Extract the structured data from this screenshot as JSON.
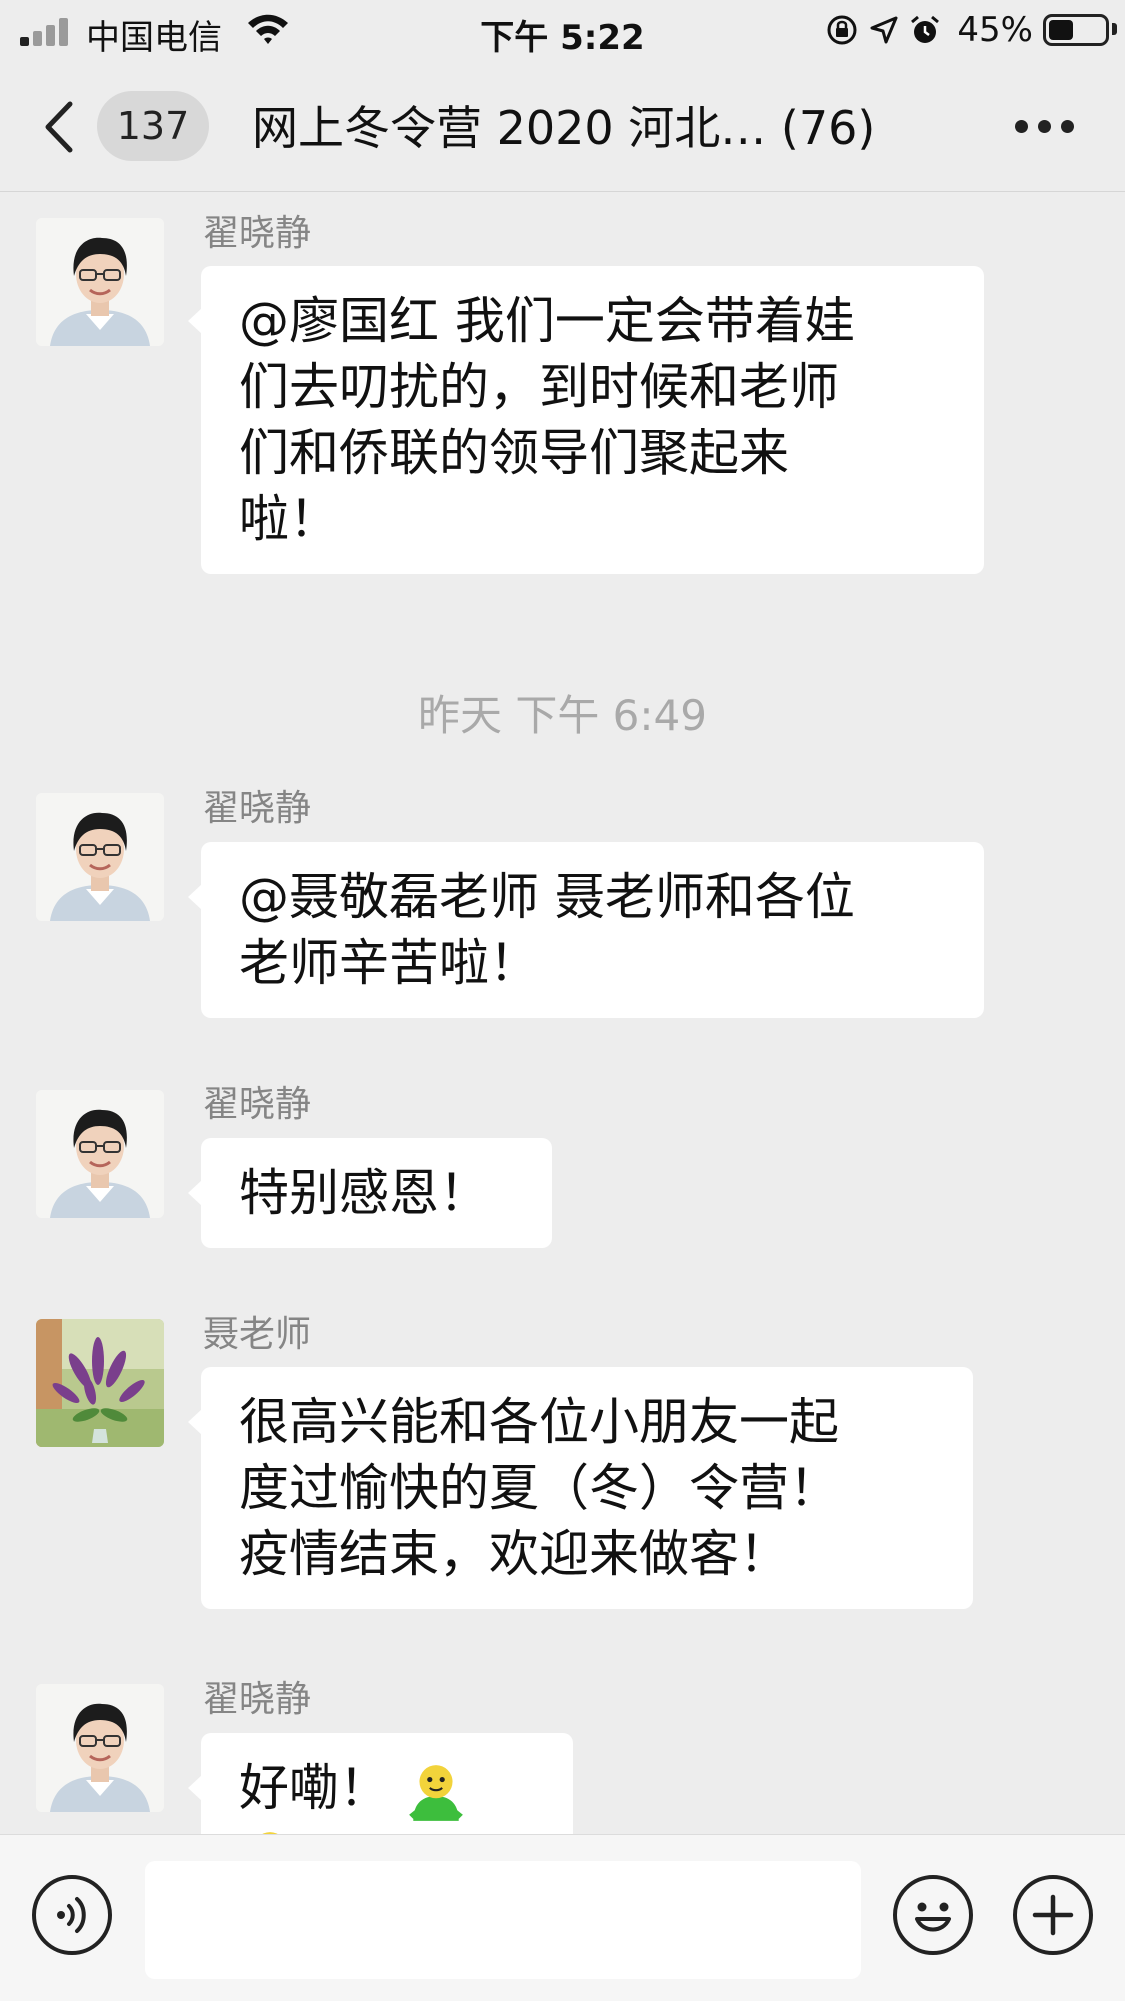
{
  "status_bar": {
    "carrier": "中国电信",
    "time": "下午 5:22",
    "battery_percent": "45%",
    "battery_level": 0.45,
    "icons": [
      "signal-icon",
      "wifi-icon",
      "orientation-lock-icon",
      "location-icon",
      "alarm-icon",
      "battery-icon"
    ]
  },
  "nav": {
    "back_icon": "chevron-left-icon",
    "unread_count": "137",
    "title": "网上冬令营 2020 河北… (76)",
    "more_icon": "more-icon"
  },
  "messages": [
    {
      "sender": "翟晓静",
      "lines": [
        "@廖国红 我们一定会带着娃",
        "们去叨扰的，到时候和老师",
        "们和侨联的领导们聚起来",
        "啦！"
      ],
      "avatar": "portrait-avatar"
    },
    {
      "timestamp": "昨天 下午 6:49"
    },
    {
      "sender": "翟晓静",
      "lines": [
        "@聂敬磊老师 聂老师和各位",
        "老师辛苦啦！"
      ],
      "avatar": "portrait-avatar"
    },
    {
      "sender": "翟晓静",
      "lines": [
        "特别感恩！"
      ],
      "avatar": "portrait-avatar"
    },
    {
      "sender": "聂老师",
      "lines": [
        "很高兴能和各位小朋友一起",
        "度过愉快的夏（冬）令营！",
        "疫情结束，欢迎来做客！"
      ],
      "avatar": "flower-avatar"
    },
    {
      "sender": "翟晓静",
      "lines": [
        "好嘞！"
      ],
      "stickers": [
        "green-person-sticker",
        "green-person-sticker"
      ],
      "avatar": "portrait-avatar"
    }
  ],
  "input_bar": {
    "voice_icon": "voice-icon",
    "text_value": "",
    "emoji_icon": "emoji-icon",
    "plus_icon": "plus-icon"
  },
  "colors": {
    "background": "#EDEDED",
    "bubble": "#FFFFFF",
    "sender_name": "#858585",
    "timestamp": "#A9A9A9",
    "sticker_green": "#3DBE3D",
    "sticker_yellow": "#F2D33B"
  }
}
